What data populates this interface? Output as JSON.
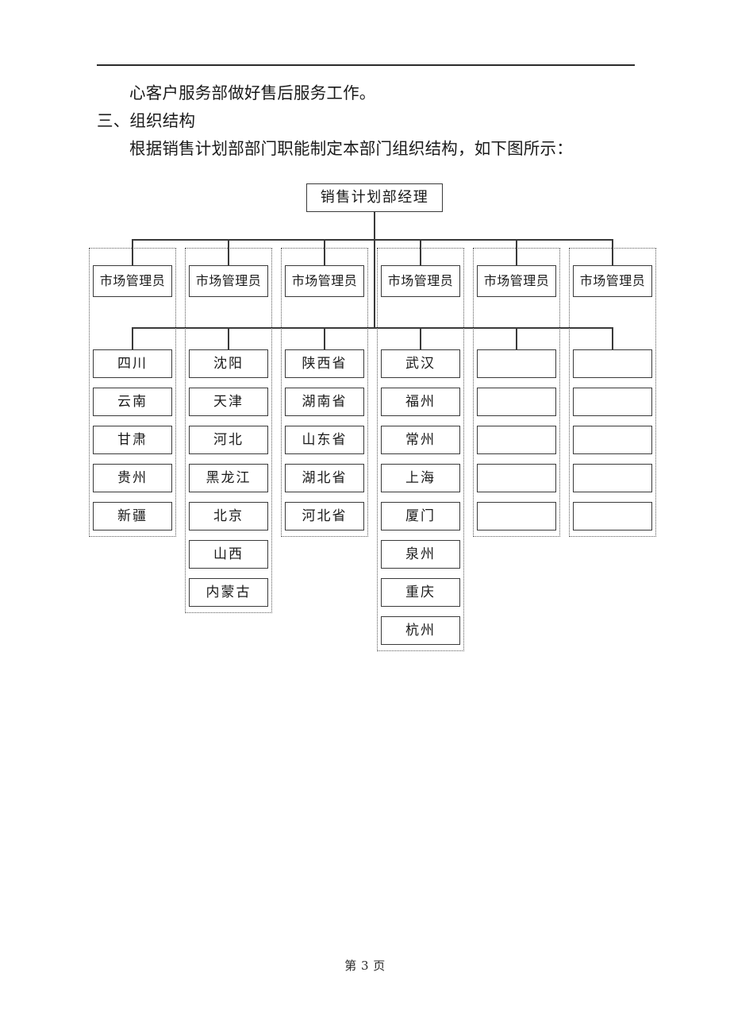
{
  "document": {
    "header_rule": "horizontal-rule",
    "paragraphs": [
      {
        "text": "心客户服务部做好售后服务工作。",
        "style": "indent-2"
      },
      {
        "text": "三、组织结构",
        "style": "heading"
      },
      {
        "text": "根据销售计划部部门职能制定本部门组织结构，如下图所示：",
        "style": "indent-1"
      }
    ],
    "footer": "第 3 页"
  },
  "org_chart": {
    "root": {
      "label": "销售计划部经理"
    },
    "manager_label": "市场管理员",
    "columns": [
      {
        "manager": "市场管理员",
        "items": [
          "四川",
          "云南",
          "甘肃",
          "贵州",
          "新疆"
        ]
      },
      {
        "manager": "市场管理员",
        "items": [
          "沈阳",
          "天津",
          "河北",
          "黑龙江",
          "北京",
          "山西",
          "内蒙古"
        ]
      },
      {
        "manager": "市场管理员",
        "items": [
          "陕西省",
          "湖南省",
          "山东省",
          "湖北省",
          "河北省"
        ]
      },
      {
        "manager": "市场管理员",
        "items": [
          "武汉",
          "福州",
          "常州",
          "上海",
          "厦门",
          "泉州",
          "重庆",
          "杭州"
        ]
      },
      {
        "manager": "市场管理员",
        "items": [
          "",
          "",
          "",
          "",
          ""
        ]
      },
      {
        "manager": "市场管理员",
        "items": [
          "",
          "",
          "",
          "",
          ""
        ]
      }
    ]
  },
  "colors": {
    "line": "#3a3a3a",
    "dotted": "#5a5a5a",
    "text": "#1a1a1a",
    "page_background": "#ffffff"
  }
}
